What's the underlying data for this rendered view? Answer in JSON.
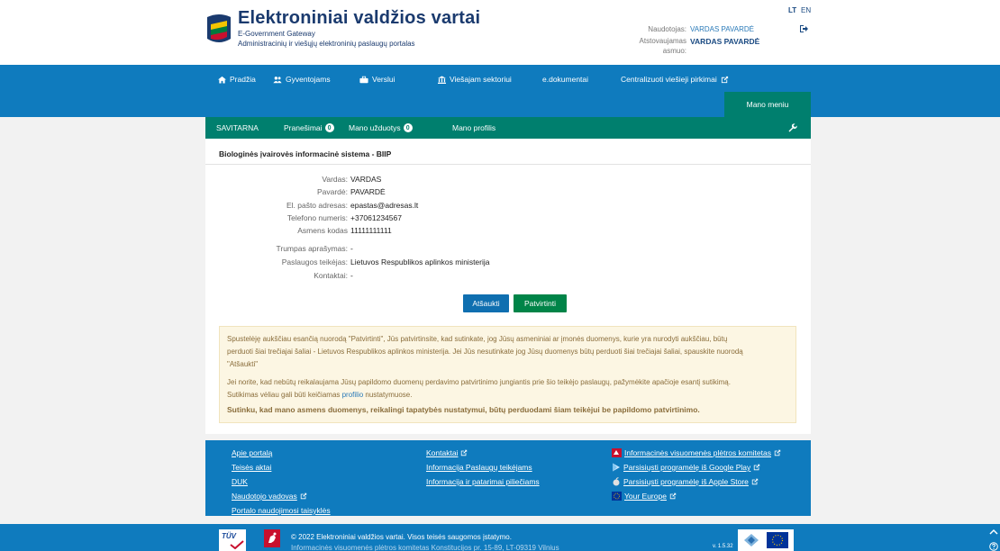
{
  "header": {
    "title": "Elektroniniai valdžios vartai",
    "subtitle_en": "E-Government Gateway",
    "subtitle_lt": "Administracinių ir viešųjų elektroninių paslaugų portalas",
    "user_label": "Naudotojas:",
    "user_value": "VARDAS PAVARDĖ",
    "represent_label_1": "Atstovaujamas",
    "represent_label_2": "asmuo:",
    "represent_value": "VARDAS PAVARDĖ",
    "lang_lt": "LT",
    "lang_en": "EN"
  },
  "nav": {
    "items": [
      {
        "label": "Pradžia",
        "icon": "home-icon"
      },
      {
        "label": "Gyventojams",
        "icon": "people-icon"
      },
      {
        "label": "Verslui",
        "icon": "briefcase-icon"
      },
      {
        "label": "Viešajam sektoriui",
        "icon": "institution-icon"
      },
      {
        "label": "e.dokumentai",
        "icon": ""
      },
      {
        "label": "Centralizuoti viešieji pirkimai",
        "icon": "external-link-icon"
      }
    ],
    "menu_button": "Mano meniu"
  },
  "subnav": {
    "items": [
      {
        "label": "SAVITARNA"
      },
      {
        "label": "Pranešimai",
        "badge": "0"
      },
      {
        "label": "Mano užduotys",
        "badge": "0"
      },
      {
        "label": "Mano profilis"
      }
    ]
  },
  "panel": {
    "title": "Biologinės įvairovės informacinė sistema - BIIP",
    "fields": [
      {
        "label": "Vardas:",
        "value": "VARDAS"
      },
      {
        "label": "Pavardė:",
        "value": "PAVARDĖ"
      },
      {
        "label": "El. pašto adresas:",
        "value": "epastas@adresas.lt"
      },
      {
        "label": "Telefono numeris:",
        "value": "+37061234567"
      },
      {
        "label": "Asmens kodas",
        "value": "11111111111"
      },
      {
        "label": "Trumpas aprašymas:",
        "value": "-"
      },
      {
        "label": "Paslaugos teikėjas:",
        "value": "Lietuvos Respublikos aplinkos ministerija"
      },
      {
        "label": "Kontaktai:",
        "value": "-"
      }
    ],
    "cancel_label": "Atšaukti",
    "confirm_label": "Patvirtinti"
  },
  "info": {
    "line1": "Spustelėję aukščiau esančią nuorodą \"Patvirtinti\", Jūs patvirtinsite, kad sutinkate, jog Jūsų asmeniniai ar įmonės duomenys, kurie yra nurodyti aukščiau, būtų",
    "line2": "perduoti šiai trečiajai šaliai - Lietuvos Respublikos aplinkos ministerija. Jei Jūs nesutinkate jog Jūsų duomenys būtų perduoti šiai trečiajai šaliai, spauskite nuorodą",
    "line3": "\"Atšaukti\"",
    "line4": "Jei norite, kad nebūtų reikalaujama Jūsų papildomo duomenų perdavimo patvirtinimo jungiantis prie šio teikėjo paslaugų, pažymėkite apačioje esantį sutikimą.",
    "line5_pre": "Sutikimas vėliau gali būti keičiamas ",
    "line5_link": "profilio",
    "line5_post": " nustatymuose.",
    "consent": "Sutinku, kad mano asmens duomenys, reikalingi tapatybės nustatymui, būtų perduodami šiam teikėjui be papildomo patvirtinimo."
  },
  "footer": {
    "col1": [
      "Apie portalą",
      "Teisės aktai",
      "DUK",
      "Naudotojo vadovas",
      "Portalo naudojimosi taisyklės"
    ],
    "col2": [
      "Kontaktai",
      "Informacija Paslaugų teikėjams",
      "Informacija ir patarimai piliečiams"
    ],
    "col3": [
      "Informacinės visuomenės plėtros komitetas",
      "Parsisiųsti programėlę iš Google Play",
      "Parsisiųsti programėlę iš Apple Store",
      "Your Europe"
    ],
    "copyright": "© 2022 Elektroniniai valdžios vartai. Visos teisės saugomos įstatymo.",
    "address": "Informacinės visuomenės plėtros komitetas Konstitucijos pr. 15-89, LT-09319 Vilnius",
    "version": "v. 1.5.32",
    "tuv": "TÜV"
  },
  "colors": {
    "primary": "#0f7bbe",
    "green": "#007f6e",
    "confirm": "#008448",
    "notice_bg": "#fcf6e3"
  }
}
